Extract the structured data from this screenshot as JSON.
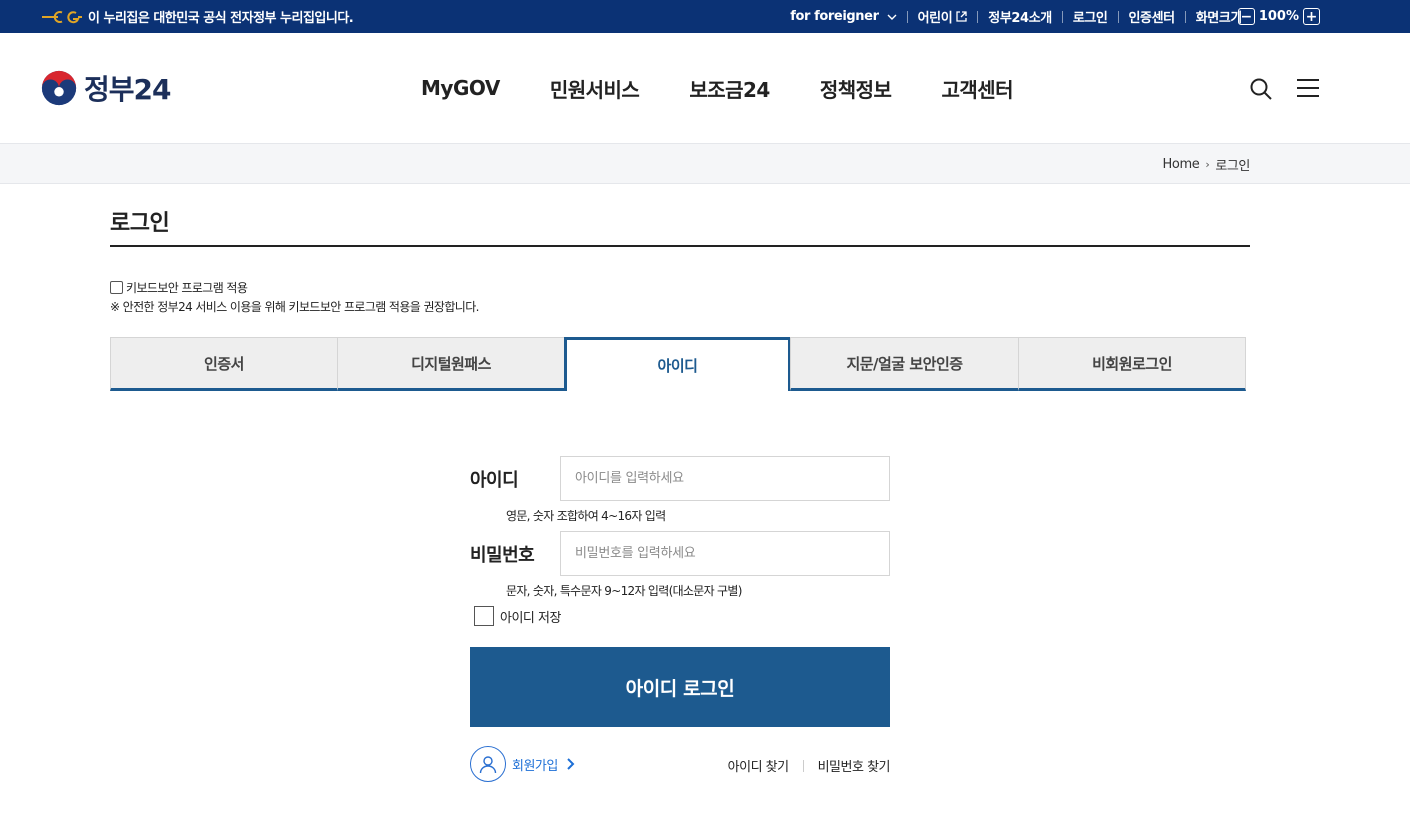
{
  "topbar": {
    "notice": "이 누리집은 대한민국 공식 전자정부 누리집입니다.",
    "foreigner": "for foreigner",
    "kids": "어린이",
    "about": "정부24소개",
    "login": "로그인",
    "cert_center": "인증센터",
    "screen_size": "화면크기",
    "zoom_minus": "−",
    "zoom_level": "100%",
    "zoom_plus": "+"
  },
  "header": {
    "logo_text": "정부24",
    "menus": [
      "MyGOV",
      "민원서비스",
      "보조금24",
      "정책정보",
      "고객센터"
    ]
  },
  "breadcrumb": {
    "home": "Home",
    "current": "로그인"
  },
  "page": {
    "title": "로그인",
    "keyboard_security_label": "키보드보안 프로그램 적용",
    "keyboard_security_note": "※ 안전한 정부24 서비스 이용을 위해 키보드보안 프로그램 적용을 권장합니다."
  },
  "tabs": [
    {
      "label": "인증서"
    },
    {
      "label": "디지털원패스"
    },
    {
      "label": "아이디"
    },
    {
      "label": "지문/얼굴 보안인증"
    },
    {
      "label": "비회원로그인"
    }
  ],
  "form": {
    "id_label": "아이디",
    "id_value": "",
    "id_placeholder": "아이디를 입력하세요",
    "id_hint": "영문, 숫자 조합하여 4~16자 입력",
    "pw_label": "비밀번호",
    "pw_value": "",
    "pw_placeholder": "비밀번호를 입력하세요",
    "pw_hint": "문자, 숫자, 특수문자 9~12자 입력(대소문자 구별)",
    "save_id_label": "아이디 저장",
    "login_button": "아이디 로그인",
    "join_label": "회원가입",
    "find_id": "아이디 찾기",
    "find_pw": "비밀번호 찾기"
  },
  "colors": {
    "topbar_bg": "#0b3275",
    "accent": "#1d5a8f",
    "link_blue": "#1d6fd6"
  }
}
